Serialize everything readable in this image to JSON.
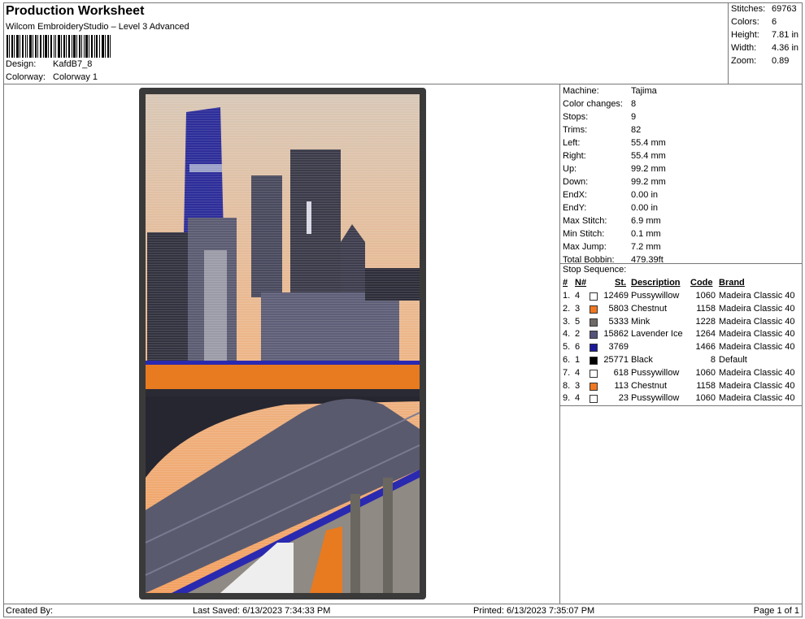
{
  "header": {
    "title": "Production Worksheet",
    "subtitle": "Wilcom EmbroideryStudio – Level 3 Advanced",
    "design_label": "Design:",
    "design_value": "KafdB7_8",
    "colorway_label": "Colorway:",
    "colorway_value": "Colorway 1"
  },
  "summary": {
    "stitches_label": "Stitches:",
    "stitches": "69763",
    "colors_label": "Colors:",
    "colors": "6",
    "height_label": "Height:",
    "height": "7.81 in",
    "width_label": "Width:",
    "width": "4.36 in",
    "zoom_label": "Zoom:",
    "zoom": "0.89"
  },
  "info": {
    "machine_label": "Machine:",
    "machine": "Tajima",
    "color_changes_label": "Color changes:",
    "color_changes": "8",
    "stops_label": "Stops:",
    "stops": "9",
    "trims_label": "Trims:",
    "trims": "82",
    "left_label": "Left:",
    "left": "55.4 mm",
    "right_label": "Right:",
    "right": "55.4 mm",
    "up_label": "Up:",
    "up": "99.2 mm",
    "down_label": "Down:",
    "down": "99.2 mm",
    "endx_label": "EndX:",
    "endx": "0.00 in",
    "endy_label": "EndY:",
    "endy": "0.00 in",
    "max_stitch_label": "Max Stitch:",
    "max_stitch": "6.9 mm",
    "min_stitch_label": "Min Stitch:",
    "min_stitch": "0.1 mm",
    "max_jump_label": "Max Jump:",
    "max_jump": "7.2 mm",
    "total_bobbin_label": "Total Bobbin:",
    "total_bobbin": "479.39ft",
    "stop_sequence_label": "Stop Sequence:"
  },
  "stop_table": {
    "headers": {
      "num": "#",
      "n": "N#",
      "st": "St.",
      "description": "Description",
      "code": "Code",
      "brand": "Brand"
    },
    "rows": [
      {
        "num": "1.",
        "n": "4",
        "color": "#ffffff",
        "st": "12469",
        "description": "Pussywillow",
        "code": "1060",
        "brand": "Madeira Classic 40"
      },
      {
        "num": "2.",
        "n": "3",
        "color": "#f07820",
        "st": "5803",
        "description": "Chestnut",
        "code": "1158",
        "brand": "Madeira Classic 40"
      },
      {
        "num": "3.",
        "n": "5",
        "color": "#6e6a66",
        "st": "5333",
        "description": "Mink",
        "code": "1228",
        "brand": "Madeira Classic 40"
      },
      {
        "num": "4.",
        "n": "2",
        "color": "#54547a",
        "st": "15862",
        "description": "Lavender Ice",
        "code": "1264",
        "brand": "Madeira Classic 40"
      },
      {
        "num": "5.",
        "n": "6",
        "color": "#1a1a9a",
        "st": "3769",
        "description": "",
        "code": "1466",
        "brand": "Madeira Classic 40"
      },
      {
        "num": "6.",
        "n": "1",
        "color": "#000000",
        "st": "25771",
        "description": "Black",
        "code": "8",
        "brand": "Default"
      },
      {
        "num": "7.",
        "n": "4",
        "color": "#ffffff",
        "st": "618",
        "description": "Pussywillow",
        "code": "1060",
        "brand": "Madeira Classic 40"
      },
      {
        "num": "8.",
        "n": "3",
        "color": "#f07820",
        "st": "113",
        "description": "Chestnut",
        "code": "1158",
        "brand": "Madeira Classic 40"
      },
      {
        "num": "9.",
        "n": "4",
        "color": "#ffffff",
        "st": "23",
        "description": "Pussywillow",
        "code": "1060",
        "brand": "Madeira Classic 40"
      }
    ]
  },
  "footer": {
    "created_by": "Created By:",
    "last_saved": "Last Saved: 6/13/2023 7:34:33 PM",
    "printed": "Printed: 6/13/2023 7:35:07 PM",
    "page": "Page 1 of 1"
  }
}
